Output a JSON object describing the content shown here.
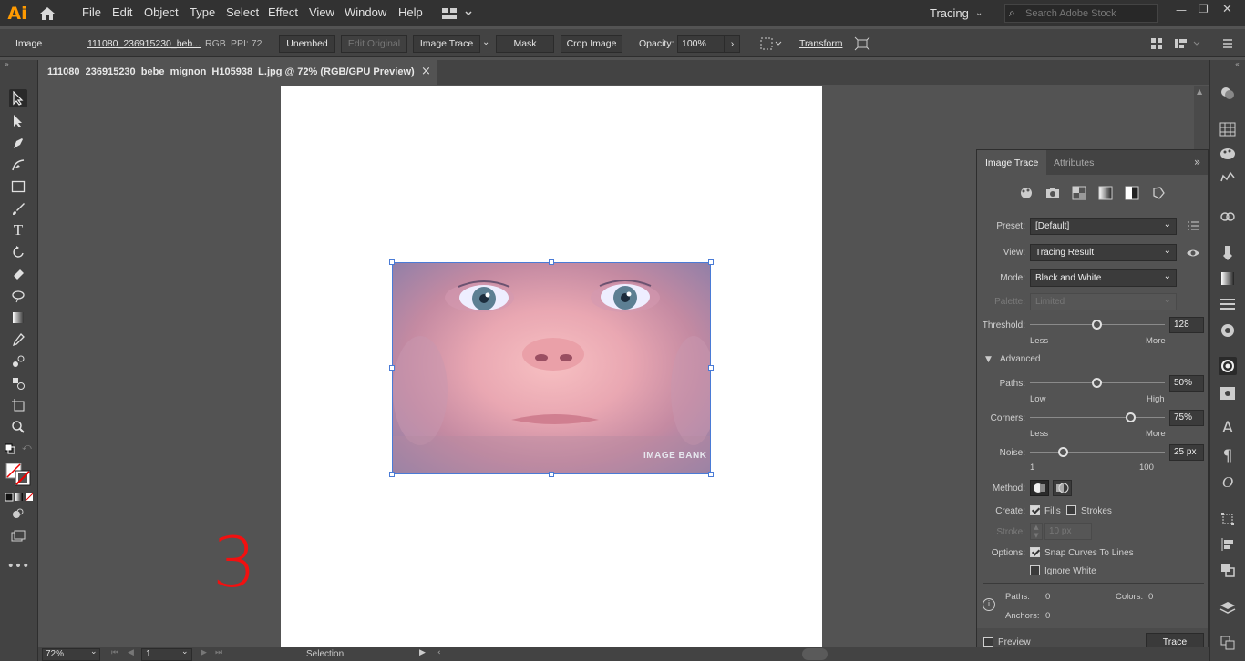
{
  "app": {
    "logo": "Ai",
    "workspace": "Tracing",
    "search_placeholder": "Search Adobe Stock"
  },
  "menu": [
    "File",
    "Edit",
    "Object",
    "Type",
    "Select",
    "Effect",
    "View",
    "Window",
    "Help"
  ],
  "control": {
    "object_type": "Image",
    "filename": "111080_236915230_beb...",
    "color_mode": "RGB",
    "ppi": "PPI: 72",
    "unembed": "Unembed",
    "edit_original": "Edit Original",
    "image_trace": "Image Trace",
    "mask": "Mask",
    "crop_image": "Crop Image",
    "opacity_label": "Opacity:",
    "opacity_value": "100%",
    "transform": "Transform"
  },
  "document_tab": {
    "title": "111080_236915230_bebe_mignon_H105938_L.jpg @ 72% (RGB/GPU Preview)",
    "close": "×"
  },
  "canvas": {
    "annotation": "3",
    "watermark_text": "IMAGE BANK"
  },
  "panel": {
    "tabs": [
      "Image Trace",
      "Attributes"
    ],
    "preset_label": "Preset:",
    "preset_value": "[Default]",
    "view_label": "View:",
    "view_value": "Tracing Result",
    "mode_label": "Mode:",
    "mode_value": "Black and White",
    "palette_label": "Palette:",
    "palette_value": "Limited",
    "threshold_label": "Threshold:",
    "threshold_value": "128",
    "threshold_min": "Less",
    "threshold_max": "More",
    "threshold_level": 0.5,
    "advanced_label": "Advanced",
    "paths_label": "Paths:",
    "paths_value": "50%",
    "paths_min": "Low",
    "paths_max": "High",
    "paths_level": 0.5,
    "corners_label": "Corners:",
    "corners_value": "75%",
    "corners_min": "Less",
    "corners_max": "More",
    "corners_level": 0.75,
    "noise_label": "Noise:",
    "noise_value": "25 px",
    "noise_min": "1",
    "noise_max": "100",
    "noise_level": 0.25,
    "method_label": "Method:",
    "create_label": "Create:",
    "fills_label": "Fills",
    "strokes_label": "Strokes",
    "stroke_label": "Stroke:",
    "stroke_value": "10 px",
    "options_label": "Options:",
    "snap_label": "Snap Curves To Lines",
    "ignore_white_label": "Ignore White",
    "info_paths_label": "Paths:",
    "info_paths_value": "0",
    "info_colors_label": "Colors:",
    "info_colors_value": "0",
    "info_anchors_label": "Anchors:",
    "info_anchors_value": "0",
    "preview_label": "Preview",
    "trace_button": "Trace"
  },
  "status": {
    "zoom": "72%",
    "artboard": "1",
    "tool": "Selection"
  }
}
